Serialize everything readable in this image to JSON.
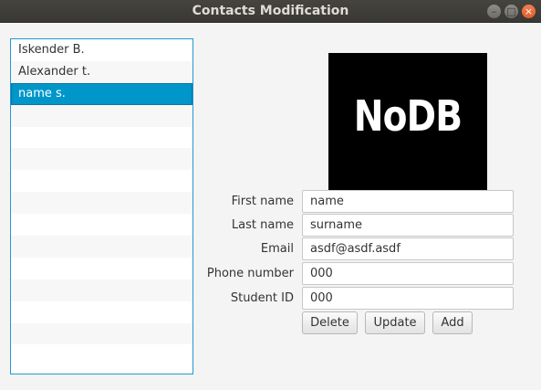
{
  "window": {
    "title": "Contacts Modification",
    "controls": {
      "minimize": "–",
      "maximize": "□",
      "close": "×"
    }
  },
  "contacts": {
    "items": [
      "Iskender B.",
      "Alexander t.",
      "name s."
    ],
    "selected_index": 2,
    "visible_rows": 15
  },
  "logo": {
    "text": "NoDB"
  },
  "form": {
    "first_name": {
      "label": "First name",
      "value": "name"
    },
    "last_name": {
      "label": "Last name",
      "value": "surname"
    },
    "email": {
      "label": "Email",
      "value": "asdf@asdf.asdf"
    },
    "phone": {
      "label": "Phone number",
      "value": "000"
    },
    "student_id": {
      "label": "Student ID",
      "value": "000"
    }
  },
  "buttons": {
    "delete": "Delete",
    "update": "Update",
    "add": "Add"
  },
  "colors": {
    "selection": "#0096c9",
    "focus_border": "#1f9ad2",
    "titlebar": "#3c3b37"
  }
}
